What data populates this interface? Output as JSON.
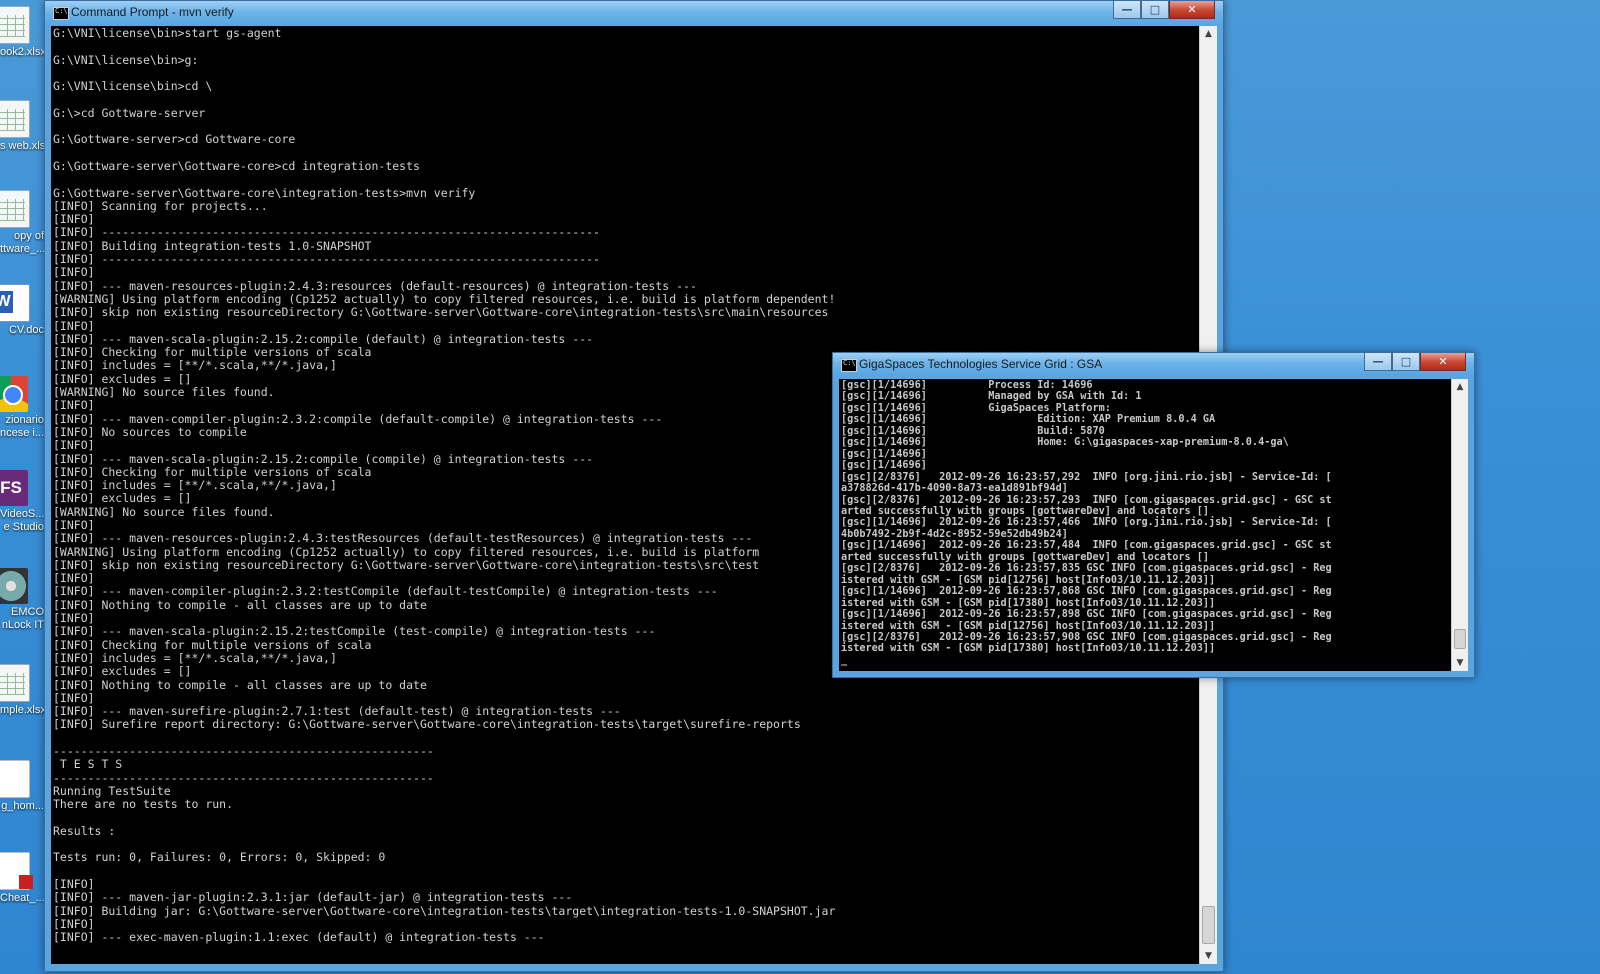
{
  "desktop": {
    "icons": [
      {
        "label": "ook2.xlsx",
        "icon": "excel-file-icon"
      },
      {
        "label": "s web.xls",
        "icon": "excel-file-icon"
      },
      {
        "label": "opy of",
        "label2": "ttware_...",
        "icon": "excel-file-icon"
      },
      {
        "label": "CV.doc",
        "icon": "word-doc-icon"
      },
      {
        "label": "zionario",
        "label2": "ncese i...",
        "icon": "chrome-icon"
      },
      {
        "label": "VideoS...",
        "label2": "e Studio",
        "icon": "fs-app-icon"
      },
      {
        "label": "EMCO",
        "label2": "nLock IT",
        "icon": "disc-app-icon"
      },
      {
        "label": "mple.xlsx",
        "icon": "excel-file-icon"
      },
      {
        "label": "g_hom...",
        "icon": "blank-file-icon"
      },
      {
        "label": "Cheat_...",
        "icon": "pdf-file-icon"
      }
    ]
  },
  "cmd_window": {
    "title": "Command Prompt - mvn  verify",
    "buttons": {
      "minimize": "—",
      "maximize": "□",
      "close": "✕"
    },
    "scroll_up": "▲",
    "scroll_down": "▼",
    "lines": [
      "G:\\VNI\\license\\bin>start gs-agent",
      "",
      "G:\\VNI\\license\\bin>g:",
      "",
      "G:\\VNI\\license\\bin>cd \\",
      "",
      "G:\\>cd Gottware-server",
      "",
      "G:\\Gottware-server>cd Gottware-core",
      "",
      "G:\\Gottware-server\\Gottware-core>cd integration-tests",
      "",
      "G:\\Gottware-server\\Gottware-core\\integration-tests>mvn verify",
      "[INFO] Scanning for projects...",
      "[INFO]",
      "[INFO] ------------------------------------------------------------------------",
      "[INFO] Building integration-tests 1.0-SNAPSHOT",
      "[INFO] ------------------------------------------------------------------------",
      "[INFO]",
      "[INFO] --- maven-resources-plugin:2.4.3:resources (default-resources) @ integration-tests ---",
      "[WARNING] Using platform encoding (Cp1252 actually) to copy filtered resources, i.e. build is platform dependent!",
      "[INFO] skip non existing resourceDirectory G:\\Gottware-server\\Gottware-core\\integration-tests\\src\\main\\resources",
      "[INFO]",
      "[INFO] --- maven-scala-plugin:2.15.2:compile (default) @ integration-tests ---",
      "[INFO] Checking for multiple versions of scala",
      "[INFO] includes = [**/*.scala,**/*.java,]",
      "[INFO] excludes = []",
      "[WARNING] No source files found.",
      "[INFO]",
      "[INFO] --- maven-compiler-plugin:2.3.2:compile (default-compile) @ integration-tests ---",
      "[INFO] No sources to compile",
      "[INFO]",
      "[INFO] --- maven-scala-plugin:2.15.2:compile (compile) @ integration-tests ---",
      "[INFO] Checking for multiple versions of scala",
      "[INFO] includes = [**/*.scala,**/*.java,]",
      "[INFO] excludes = []",
      "[WARNING] No source files found.",
      "[INFO]",
      "[INFO] --- maven-resources-plugin:2.4.3:testResources (default-testResources) @ integration-tests ---",
      "[WARNING] Using platform encoding (Cp1252 actually) to copy filtered resources, i.e. build is platform",
      "[INFO] skip non existing resourceDirectory G:\\Gottware-server\\Gottware-core\\integration-tests\\src\\test",
      "[INFO]",
      "[INFO] --- maven-compiler-plugin:2.3.2:testCompile (default-testCompile) @ integration-tests ---",
      "[INFO] Nothing to compile - all classes are up to date",
      "[INFO]",
      "[INFO] --- maven-scala-plugin:2.15.2:testCompile (test-compile) @ integration-tests ---",
      "[INFO] Checking for multiple versions of scala",
      "[INFO] includes = [**/*.scala,**/*.java,]",
      "[INFO] excludes = []",
      "[INFO] Nothing to compile - all classes are up to date",
      "[INFO]",
      "[INFO] --- maven-surefire-plugin:2.7.1:test (default-test) @ integration-tests ---",
      "[INFO] Surefire report directory: G:\\Gottware-server\\Gottware-core\\integration-tests\\target\\surefire-reports",
      "",
      "-------------------------------------------------------",
      " T E S T S",
      "-------------------------------------------------------",
      "Running TestSuite",
      "There are no tests to run.",
      "",
      "Results :",
      "",
      "Tests run: 0, Failures: 0, Errors: 0, Skipped: 0",
      "",
      "[INFO]",
      "[INFO] --- maven-jar-plugin:2.3.1:jar (default-jar) @ integration-tests ---",
      "[INFO] Building jar: G:\\Gottware-server\\Gottware-core\\integration-tests\\target\\integration-tests-1.0-SNAPSHOT.jar",
      "[INFO]",
      "[INFO] --- exec-maven-plugin:1.1:exec (default) @ integration-tests ---"
    ]
  },
  "gsa_window": {
    "title": "GigaSpaces Technologies Service Grid : GSA",
    "buttons": {
      "minimize": "—",
      "maximize": "□",
      "close": "✕"
    },
    "scroll_up": "▲",
    "scroll_down": "▼",
    "lines": [
      "[gsc][1/14696]          Process Id: 14696",
      "[gsc][1/14696]          Managed by GSA with Id: 1",
      "[gsc][1/14696]          GigaSpaces Platform:",
      "[gsc][1/14696]                  Edition: XAP Premium 8.0.4 GA",
      "[gsc][1/14696]                  Build: 5870",
      "[gsc][1/14696]                  Home: G:\\gigaspaces-xap-premium-8.0.4-ga\\",
      "[gsc][1/14696]",
      "[gsc][1/14696]",
      "[gsc][2/8376]   2012-09-26 16:23:57,292  INFO [org.jini.rio.jsb] - Service-Id: [",
      "a378826d-417b-4090-8a73-ea1d891bf94d]",
      "[gsc][2/8376]   2012-09-26 16:23:57,293  INFO [com.gigaspaces.grid.gsc] - GSC st",
      "arted successfully with groups [gottwareDev] and locators []",
      "[gsc][1/14696]  2012-09-26 16:23:57,466  INFO [org.jini.rio.jsb] - Service-Id: [",
      "4b0b7492-2b9f-4d2c-8952-59e52db49b24]",
      "[gsc][1/14696]  2012-09-26 16:23:57,484  INFO [com.gigaspaces.grid.gsc] - GSC st",
      "arted successfully with groups [gottwareDev] and locators []",
      "[gsc][2/8376]   2012-09-26 16:23:57,835 GSC INFO [com.gigaspaces.grid.gsc] - Reg",
      "istered with GSM - [GSM pid[12756] host[Info03/10.11.12.203]]",
      "[gsc][1/14696]  2012-09-26 16:23:57,868 GSC INFO [com.gigaspaces.grid.gsc] - Reg",
      "istered with GSM - [GSM pid[17380] host[Info03/10.11.12.203]]",
      "[gsc][1/14696]  2012-09-26 16:23:57,898 GSC INFO [com.gigaspaces.grid.gsc] - Reg",
      "istered with GSM - [GSM pid[12756] host[Info03/10.11.12.203]]",
      "[gsc][2/8376]   2012-09-26 16:23:57,908 GSC INFO [com.gigaspaces.grid.gsc] - Reg",
      "istered with GSM - [GSM pid[17380] host[Info03/10.11.12.203]]",
      "_"
    ]
  }
}
